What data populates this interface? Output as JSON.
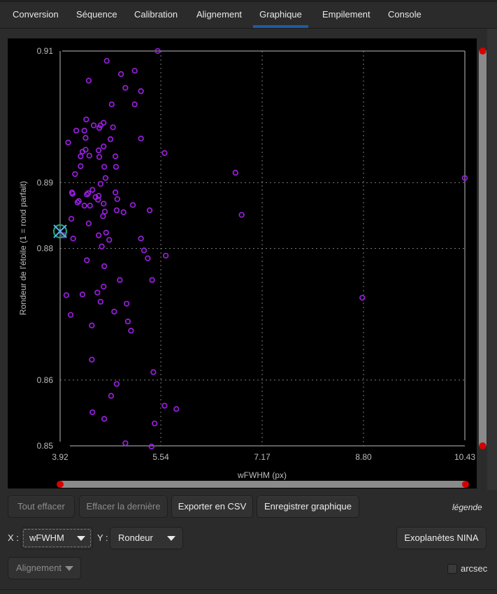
{
  "tabs": [
    {
      "label": "Conversion",
      "active": false
    },
    {
      "label": "Séquence",
      "active": false
    },
    {
      "label": "Calibration",
      "active": false
    },
    {
      "label": "Alignement",
      "active": false
    },
    {
      "label": "Graphique",
      "active": true
    },
    {
      "label": "Empilement",
      "active": false
    },
    {
      "label": "Console",
      "active": false
    }
  ],
  "toolbar": {
    "clear_all": "Tout effacer",
    "clear_last": "Effacer la dernière",
    "export_csv": "Exporter en CSV",
    "save_plot": "Enregistrer graphique",
    "legend": "légende",
    "x_label": "X :",
    "x_value": "wFWHM",
    "y_label": "Y :",
    "y_value": "Rondeur",
    "nina": "Exoplanètes NINA",
    "source_value": "Alignement",
    "arcsec_label": "arcsec",
    "arcsec_checked": false
  },
  "colors": {
    "point": "#9a1fe0",
    "marker_circle": "#1fa37a",
    "marker_cross": "#5ab4e8",
    "slider_handle": "#d40000",
    "slider_track": "#8a8a8a",
    "tab_underline": "#1e5aa8"
  },
  "chart_data": {
    "type": "scatter",
    "title": "",
    "xlabel": "wFWHM (px)",
    "ylabel": "Rondeur de l'étoile (1 = rond parfait)",
    "xlim": [
      3.92,
      10.43
    ],
    "ylim": [
      0.85,
      0.91
    ],
    "xticks": [
      "3.92",
      "5.54",
      "7.17",
      "8.80",
      "10.43"
    ],
    "xtick_values": [
      3.92,
      5.54,
      7.17,
      8.8,
      10.43
    ],
    "yticks": [
      "0.85",
      "0.86",
      "0.88",
      "0.89",
      "0.91"
    ],
    "ytick_values": [
      0.85,
      0.86,
      0.88,
      0.89,
      0.91
    ],
    "grid": true,
    "selected": {
      "x": 3.92,
      "y": 0.8826
    },
    "x_range_slider": [
      0,
      1
    ],
    "y_range_slider": [
      0,
      1
    ],
    "points": [
      [
        5.49,
        0.91
      ],
      [
        4.67,
        0.9085
      ],
      [
        5.12,
        0.907
      ],
      [
        4.9,
        0.9065
      ],
      [
        4.38,
        0.9055
      ],
      [
        4.97,
        0.9044
      ],
      [
        5.22,
        0.9039
      ],
      [
        4.75,
        0.9019
      ],
      [
        5.12,
        0.9019
      ],
      [
        4.34,
        0.8996
      ],
      [
        4.46,
        0.8987
      ],
      [
        4.57,
        0.8987
      ],
      [
        4.62,
        0.8991
      ],
      [
        4.55,
        0.8983
      ],
      [
        4.77,
        0.8984
      ],
      [
        4.18,
        0.8979
      ],
      [
        4.31,
        0.8979
      ],
      [
        4.33,
        0.8968
      ],
      [
        4.73,
        0.8966
      ],
      [
        5.22,
        0.8967
      ],
      [
        4.05,
        0.8961
      ],
      [
        4.62,
        0.8955
      ],
      [
        4.33,
        0.895
      ],
      [
        4.28,
        0.8947
      ],
      [
        4.54,
        0.8949
      ],
      [
        5.6,
        0.8945
      ],
      [
        4.25,
        0.894
      ],
      [
        4.39,
        0.8941
      ],
      [
        4.55,
        0.8939
      ],
      [
        4.81,
        0.894
      ],
      [
        4.25,
        0.8925
      ],
      [
        4.63,
        0.8924
      ],
      [
        4.82,
        0.8924
      ],
      [
        4.16,
        0.8913
      ],
      [
        4.65,
        0.8907
      ],
      [
        4.57,
        0.8898
      ],
      [
        4.11,
        0.8885
      ],
      [
        4.12,
        0.8883
      ],
      [
        4.35,
        0.8882
      ],
      [
        4.37,
        0.8884
      ],
      [
        4.44,
        0.8889
      ],
      [
        4.81,
        0.8885
      ],
      [
        4.49,
        0.8878
      ],
      [
        4.54,
        0.888
      ],
      [
        4.53,
        0.8874
      ],
      [
        4.84,
        0.8875
      ],
      [
        4.22,
        0.8872
      ],
      [
        4.2,
        0.887
      ],
      [
        4.31,
        0.8865
      ],
      [
        4.4,
        0.8865
      ],
      [
        4.62,
        0.8868
      ],
      [
        5.09,
        0.8866
      ],
      [
        4.64,
        0.8856
      ],
      [
        4.83,
        0.8858
      ],
      [
        4.94,
        0.8855
      ],
      [
        5.36,
        0.8858
      ],
      [
        4.61,
        0.8849
      ],
      [
        4.1,
        0.8845
      ],
      [
        4.38,
        0.8838
      ],
      [
        4.13,
        0.8815
      ],
      [
        4.54,
        0.882
      ],
      [
        4.66,
        0.8824
      ],
      [
        4.71,
        0.8813
      ],
      [
        5.22,
        0.8815
      ],
      [
        4.59,
        0.8803
      ],
      [
        5.27,
        0.8797
      ],
      [
        5.62,
        0.8789
      ],
      [
        5.33,
        0.8785
      ],
      [
        4.35,
        0.8782
      ],
      [
        4.63,
        0.8773
      ],
      [
        4.88,
        0.8752
      ],
      [
        5.4,
        0.8752
      ],
      [
        4.62,
        0.8742
      ],
      [
        4.02,
        0.8729
      ],
      [
        4.28,
        0.873
      ],
      [
        4.52,
        0.8733
      ],
      [
        4.57,
        0.8719
      ],
      [
        4.99,
        0.8716
      ],
      [
        4.79,
        0.8704
      ],
      [
        4.09,
        0.8699
      ],
      [
        5.01,
        0.8689
      ],
      [
        4.43,
        0.8683
      ],
      [
        5.06,
        0.8675
      ],
      [
        4.43,
        0.8631
      ],
      [
        5.42,
        0.8612
      ],
      [
        4.83,
        0.8594
      ],
      [
        4.74,
        0.8576
      ],
      [
        5.6,
        0.8561
      ],
      [
        5.79,
        0.8556
      ],
      [
        4.44,
        0.8551
      ],
      [
        4.63,
        0.8541
      ],
      [
        5.44,
        0.8534
      ],
      [
        4.97,
        0.8504
      ],
      [
        5.39,
        0.8499
      ],
      [
        6.74,
        0.8915
      ],
      [
        6.84,
        0.8851
      ],
      [
        10.43,
        0.8907
      ],
      [
        8.78,
        0.8725
      ],
      [
        3.98,
        0.882
      ]
    ]
  }
}
